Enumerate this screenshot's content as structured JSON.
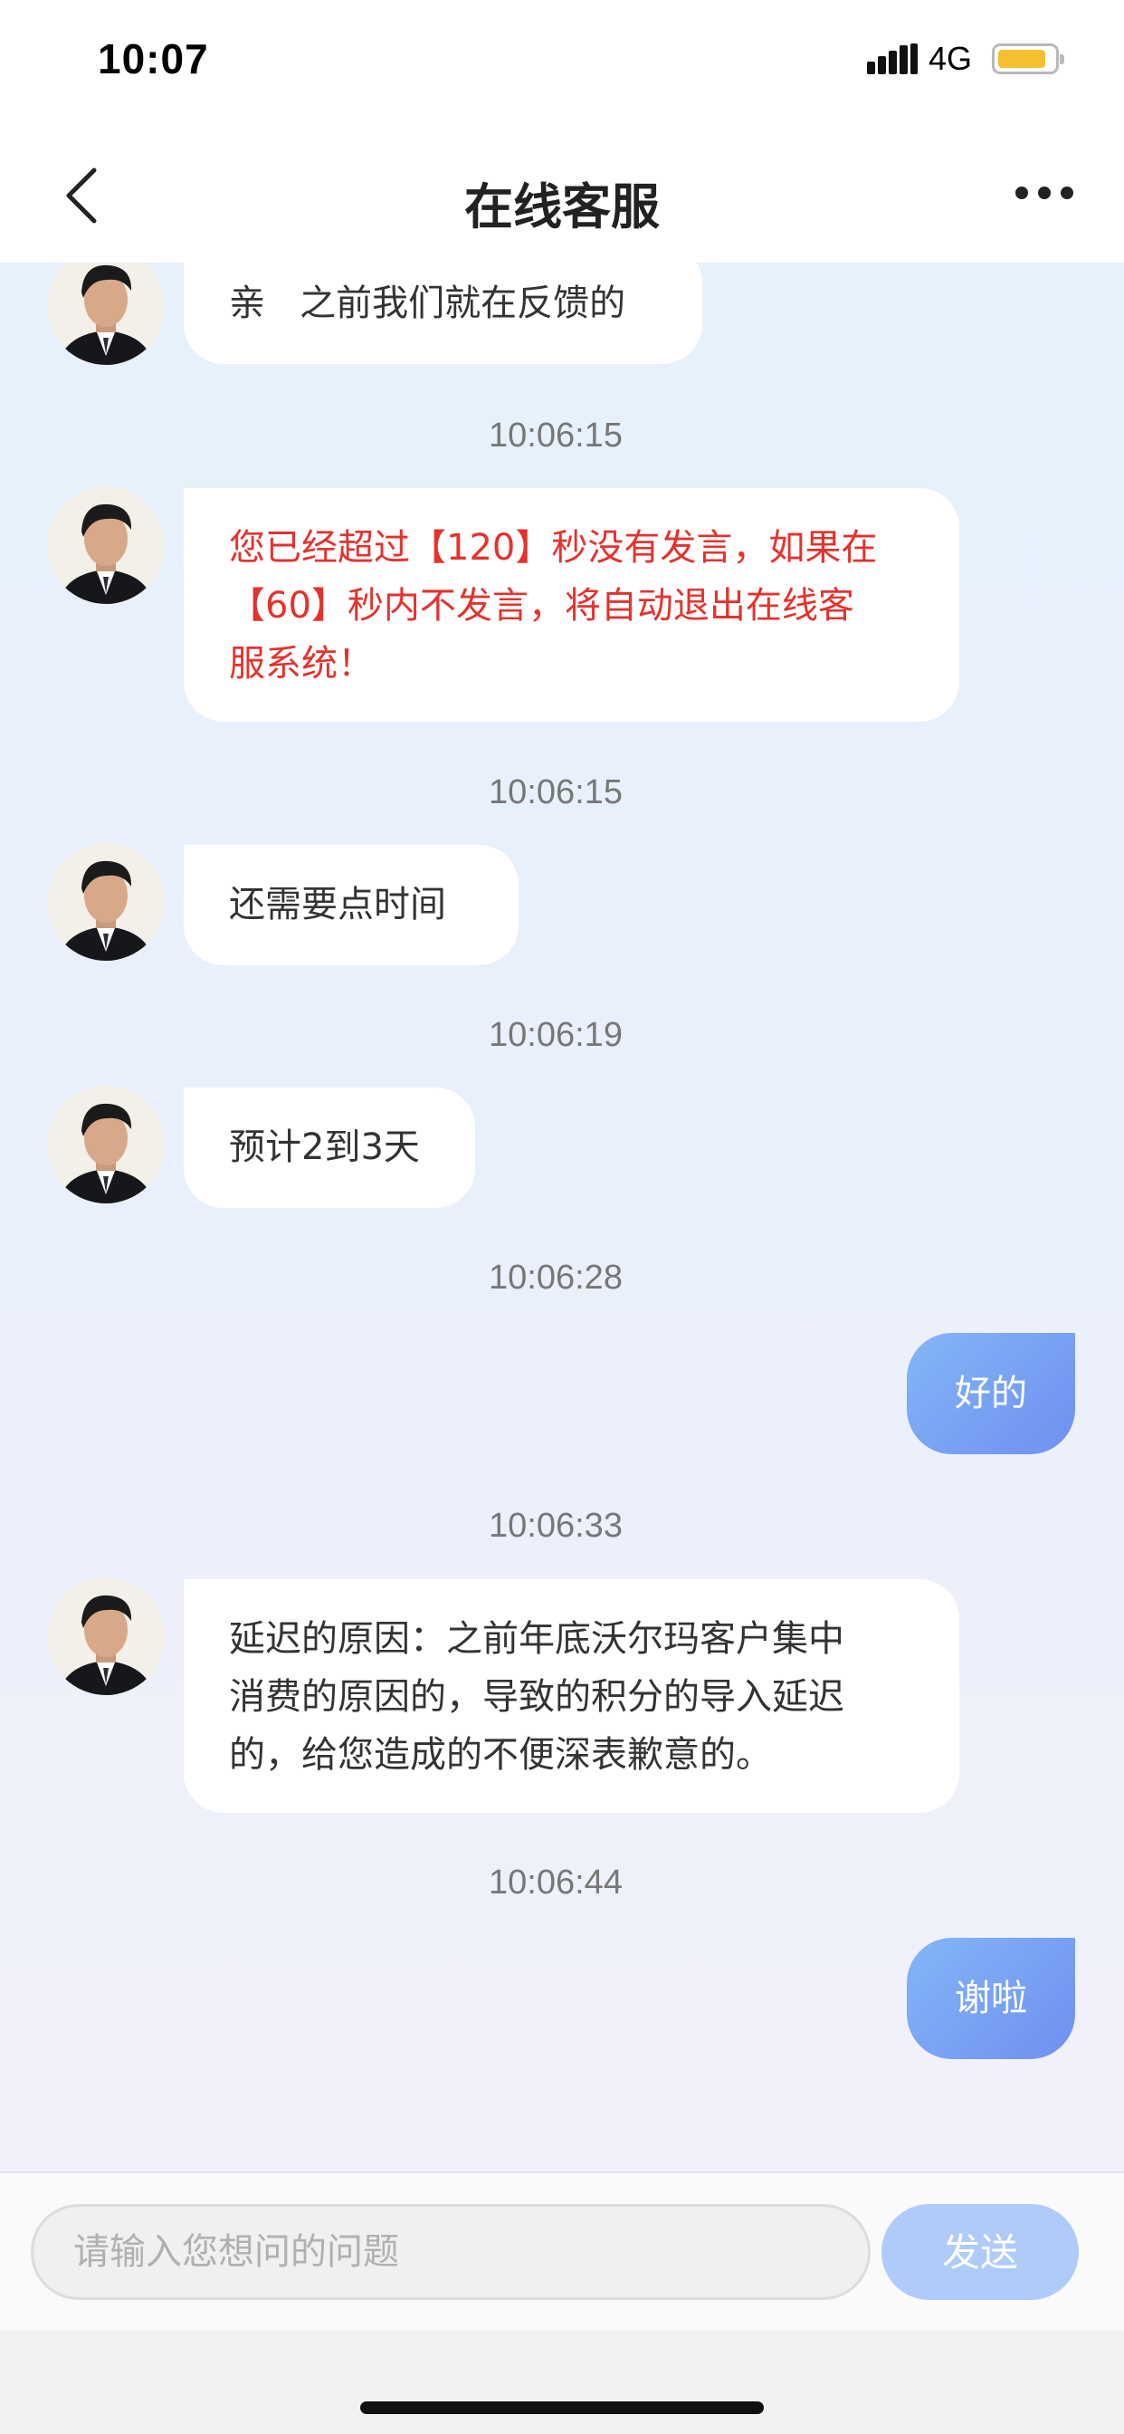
{
  "status_bar": {
    "time": "10:07",
    "network": "4G"
  },
  "header": {
    "title": "在线客服"
  },
  "messages": [
    {
      "side": "left",
      "text": "亲   之前我们就在反馈的"
    },
    {
      "timestamp": "10:06:15"
    },
    {
      "side": "left",
      "color": "#e5322d",
      "text_lines": [
        "您已经超过【120】秒没有发言，如果在",
        "【60】秒内不发言，将自动退出在线客",
        "服系统！"
      ]
    },
    {
      "timestamp": "10:06:15"
    },
    {
      "side": "left",
      "text": "还需要点时间"
    },
    {
      "timestamp": "10:06:19"
    },
    {
      "side": "left",
      "text": "预计2到3天"
    },
    {
      "timestamp": "10:06:28"
    },
    {
      "side": "right",
      "text": "好的"
    },
    {
      "timestamp": "10:06:33"
    },
    {
      "side": "left",
      "text_lines": [
        "延迟的原因：之前年底沃尔玛客户集中",
        "消费的原因的，导致的积分的导入延迟",
        "的，给您造成的不便深表歉意的。"
      ]
    },
    {
      "timestamp": "10:06:44"
    },
    {
      "side": "right",
      "text": "谢啦"
    }
  ],
  "input": {
    "placeholder": "请输入您想问的问题",
    "send_label": "发送"
  },
  "colors": {
    "accent": "#6f8ff1",
    "warning_text": "#e5322d",
    "send_disabled": "#aecbfa"
  },
  "icons": [
    "back-arrow-icon",
    "more-icon",
    "signal-icon",
    "battery-icon",
    "agent-avatar"
  ]
}
